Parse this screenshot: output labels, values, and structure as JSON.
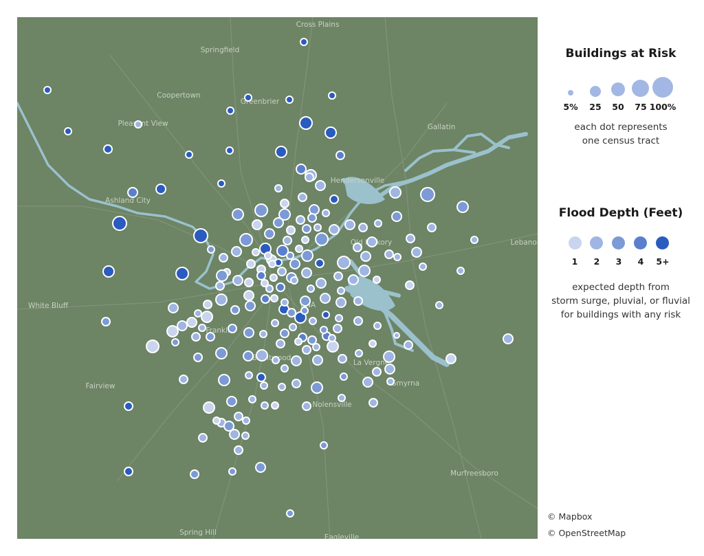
{
  "map": {
    "colors": {
      "land": "#6d8465",
      "water": "#9ac1cc",
      "road": "#88987e",
      "place_label": "#c9d2c3",
      "dot_stroke": "#ffffff"
    },
    "depth_colors": [
      "#c9d5ee",
      "#9fb5e2",
      "#7c9ad6",
      "#5b7fcc",
      "#2a5bbf"
    ],
    "place_labels": [
      "Cross Plains",
      "Springfield",
      "Coopertown",
      "Greenbrier",
      "Pleasant View",
      "Gallatin",
      "Ashland City",
      "Hendersonville",
      "Lebanon",
      "White Bluff",
      "BNA",
      "Fairview",
      "Franklin",
      "Brentwood",
      "La Vergne",
      "Smyrna",
      "Nolensville",
      "Murfreesboro",
      "Spring Hill",
      "Eagleville",
      "Old Hickory"
    ]
  },
  "legend": {
    "size_title": "Buildings at Risk",
    "size_labels": [
      "5%",
      "25",
      "50",
      "75",
      "100%"
    ],
    "size_note_lines": [
      "each dot represents",
      "one census tract"
    ],
    "depth_title": "Flood Depth (Feet)",
    "depth_labels": [
      "1",
      "2",
      "3",
      "4",
      "5+"
    ],
    "depth_note_lines": [
      "expected depth from",
      "storm surge, pluvial, or fluvial",
      "for buildings with any risk"
    ]
  },
  "credits": [
    "© Mapbox",
    "© OpenStreetMap"
  ]
}
